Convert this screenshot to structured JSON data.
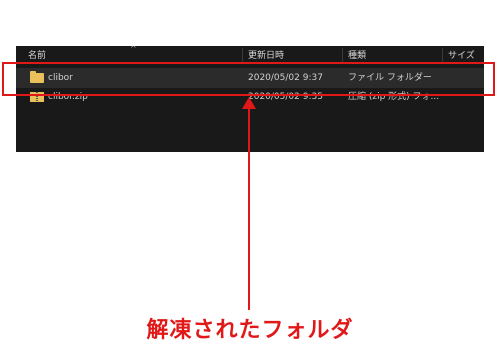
{
  "columns": {
    "name": "名前",
    "modified": "更新日時",
    "type": "種類",
    "size": "サイズ"
  },
  "files": [
    {
      "name": "clibor",
      "modified": "2020/05/02 9:37",
      "type": "ファイル フォルダー",
      "icon": "folder-icon"
    },
    {
      "name": "clibor.zip",
      "modified": "2020/05/02 9:35",
      "type": "圧縮 (zip 形式) フォ...",
      "icon": "zip-icon"
    }
  ],
  "caption": "解凍されたフォルダ",
  "colors": {
    "explorer_bg": "#191919",
    "annotation_red": "#e01818",
    "folder_yellow": "#e9c05a"
  }
}
